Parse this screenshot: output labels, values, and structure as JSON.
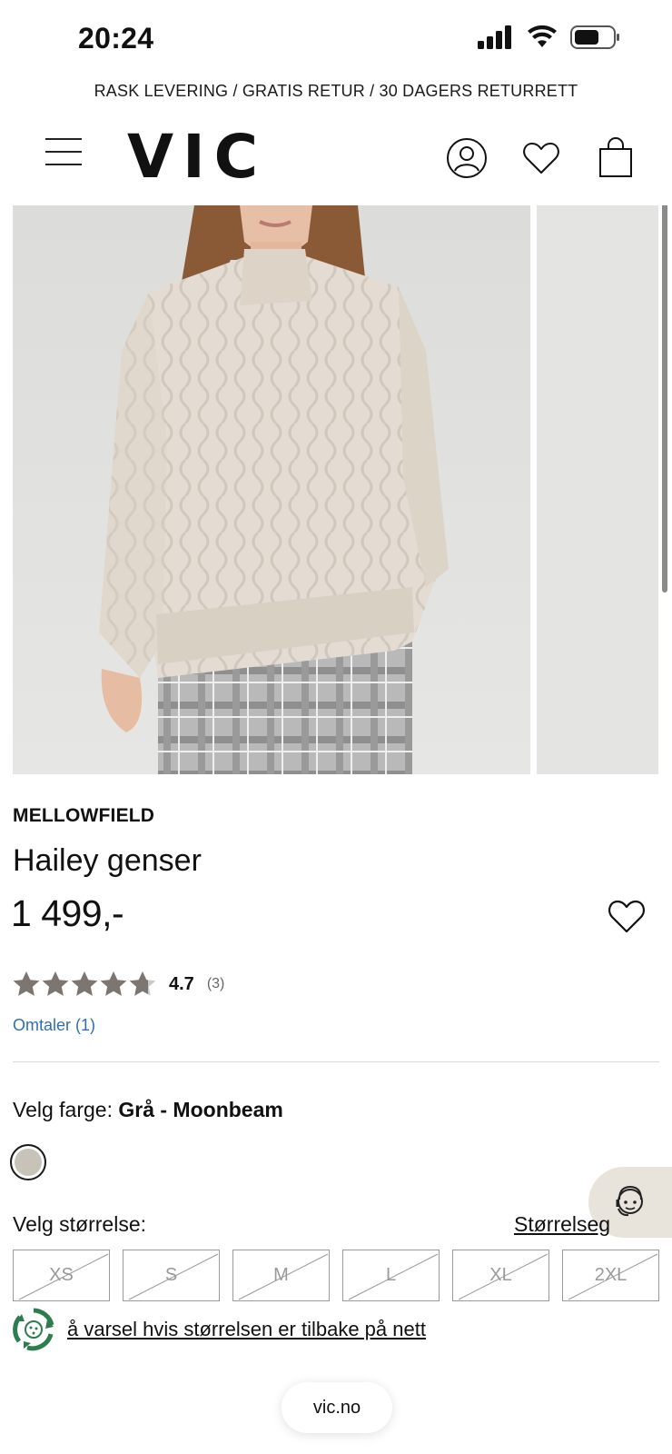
{
  "status_bar": {
    "time": "20:24"
  },
  "promo": {
    "text": "RASK LEVERING / GRATIS RETUR / 30 DAGERS RETURRETT"
  },
  "header": {
    "logo": "VIC"
  },
  "product": {
    "brand": "MELLOWFIELD",
    "name": "Hailey genser",
    "price": "1 499,-",
    "rating": {
      "value": "4.7",
      "count": "(3)",
      "stars": 4.7
    },
    "reviews_link": "Omtaler (1)"
  },
  "color": {
    "label_prefix": "Velg farge:",
    "selected": "Grå - Moonbeam",
    "swatch_color": "#c8c3b9"
  },
  "size": {
    "label": "Velg størrelse:",
    "guide_link": "Størrelseg",
    "options": [
      "XS",
      "S",
      "M",
      "L",
      "XL",
      "2XL"
    ]
  },
  "notify": {
    "text": "å varsel hvis størrelsen er tilbake på nett"
  },
  "browser": {
    "url": "vic.no"
  },
  "colors": {
    "link": "#2f6fb1",
    "star": "#7d7670",
    "star_empty": "#c9c9c9",
    "notify_icon": "#2e7d4f"
  }
}
